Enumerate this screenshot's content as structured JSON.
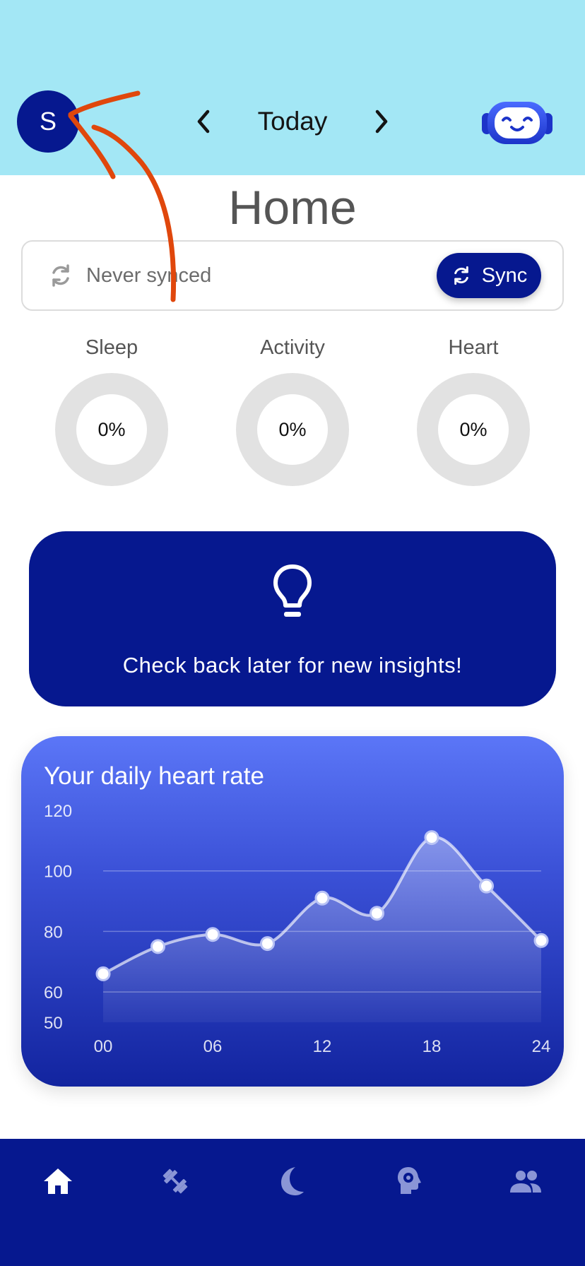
{
  "header": {
    "avatar_initial": "S",
    "date_label": "Today"
  },
  "page_title": "Home",
  "sync": {
    "status_text": "Never synced",
    "button_label": "Sync"
  },
  "metrics": [
    {
      "label": "Sleep",
      "value": "0%"
    },
    {
      "label": "Activity",
      "value": "0%"
    },
    {
      "label": "Heart",
      "value": "0%"
    }
  ],
  "insight": {
    "message": "Check back later for new insights!"
  },
  "chart_data": {
    "type": "line",
    "title": "Your daily heart rate",
    "x": [
      0,
      3,
      6,
      9,
      12,
      15,
      18,
      21,
      24
    ],
    "y": [
      66,
      75,
      79,
      76,
      91,
      86,
      111,
      95,
      77
    ],
    "x_tick_labels": [
      "00",
      "06",
      "12",
      "18",
      "24"
    ],
    "x_ticks": [
      0,
      6,
      12,
      18,
      24
    ],
    "y_ticks": [
      50,
      60,
      80,
      100,
      120
    ],
    "ylim": [
      50,
      120
    ],
    "xlim": [
      0,
      24
    ],
    "grid": true
  },
  "bottom_nav": {
    "items": [
      "home-icon",
      "dumbbell-icon",
      "moon-icon",
      "brain-gear-icon",
      "people-icon"
    ]
  },
  "colors": {
    "header_bg": "#a3e7f5",
    "primary": "#06188f",
    "chart_top": "#5b76f7",
    "chart_bottom": "#12249f",
    "ring": "#e2e2e2",
    "annotation": "#e0470c"
  }
}
